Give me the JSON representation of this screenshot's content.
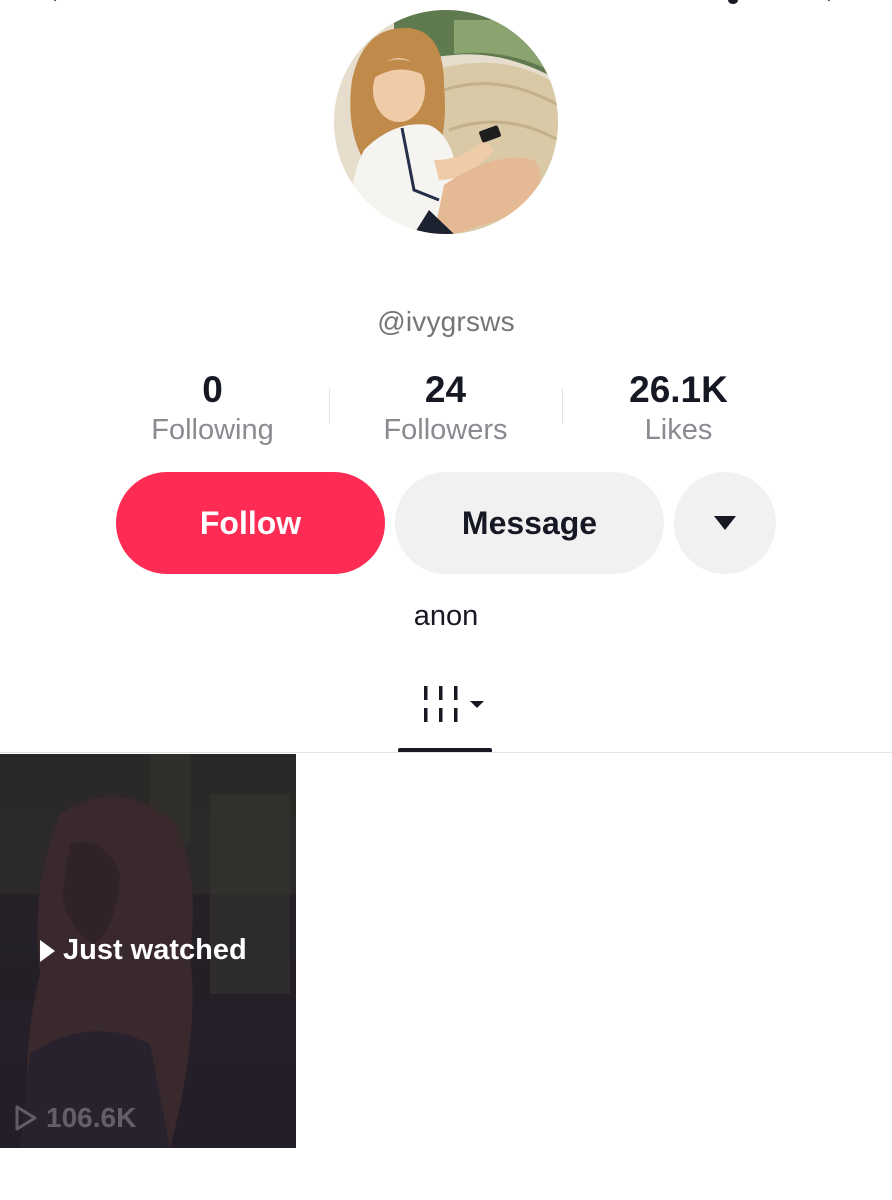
{
  "header": {
    "icons": [
      "back-icon",
      "bell-icon",
      "share-icon"
    ]
  },
  "profile": {
    "username": "@ivygrsws",
    "bio": "anon",
    "stats": [
      {
        "value": "0",
        "label": "Following"
      },
      {
        "value": "24",
        "label": "Followers"
      },
      {
        "value": "26.1K",
        "label": "Likes"
      }
    ]
  },
  "actions": {
    "follow_label": "Follow",
    "message_label": "Message",
    "more_icon": "caret-down-icon"
  },
  "tabs": {
    "active_icon": "videos-grid-icon"
  },
  "videos": [
    {
      "badge": "Just watched",
      "views": "106.6K"
    }
  ],
  "colors": {
    "accent": "#fe2c55",
    "secondary_button": "#f1f1f2",
    "muted_text": "#8a8b91",
    "primary_text": "#161823"
  }
}
